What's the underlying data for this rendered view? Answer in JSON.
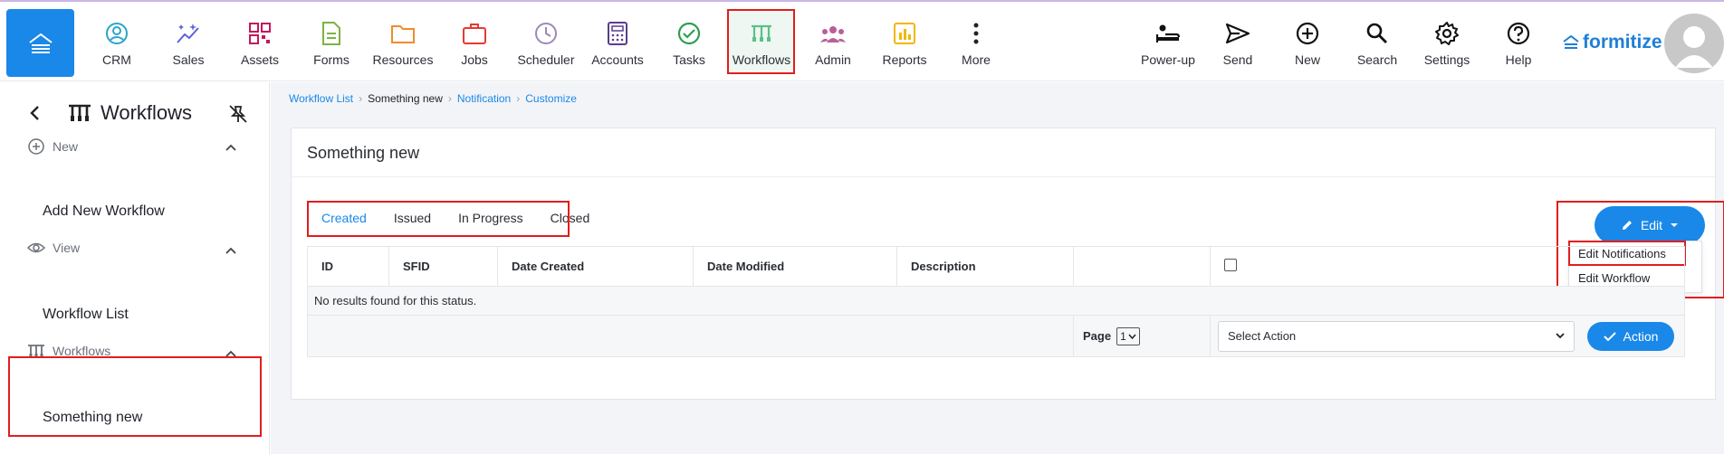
{
  "nav": {
    "items": [
      {
        "label": "CRM",
        "icon": "user-circle-icon"
      },
      {
        "label": "Sales",
        "icon": "sparkle-chart-icon"
      },
      {
        "label": "Assets",
        "icon": "qr-code-icon"
      },
      {
        "label": "Forms",
        "icon": "document-icon"
      },
      {
        "label": "Resources",
        "icon": "folder-icon"
      },
      {
        "label": "Jobs",
        "icon": "briefcase-icon"
      },
      {
        "label": "Scheduler",
        "icon": "clock-icon"
      },
      {
        "label": "Accounts",
        "icon": "calculator-icon"
      },
      {
        "label": "Tasks",
        "icon": "check-circle-icon"
      },
      {
        "label": "Workflows",
        "icon": "workflow-icon"
      },
      {
        "label": "Admin",
        "icon": "people-icon"
      },
      {
        "label": "Reports",
        "icon": "bar-chart-icon"
      },
      {
        "label": "More",
        "icon": "more-vertical-icon"
      }
    ],
    "right_items": [
      {
        "label": "Power-up",
        "icon": "power-up-icon"
      },
      {
        "label": "Send",
        "icon": "send-icon"
      },
      {
        "label": "New",
        "icon": "plus-circle-icon"
      },
      {
        "label": "Search",
        "icon": "search-icon"
      },
      {
        "label": "Settings",
        "icon": "gear-icon"
      },
      {
        "label": "Help",
        "icon": "help-icon"
      }
    ],
    "brand": "formitize"
  },
  "sidebar": {
    "title": "Workflows",
    "sections": [
      {
        "label": "New",
        "link": "Add New Workflow"
      },
      {
        "label": "View",
        "link": "Workflow List"
      },
      {
        "label": "Workflows",
        "link": "Something new"
      }
    ]
  },
  "breadcrumb": [
    "Workflow List",
    "Something new",
    "Notification",
    "Customize"
  ],
  "card": {
    "title": "Something new",
    "tabs": [
      "Created",
      "Issued",
      "In Progress",
      "Closed"
    ],
    "edit_label": "Edit",
    "dropdown": [
      "Edit Notifications",
      "Edit Workflow"
    ],
    "columns": [
      "ID",
      "SFID",
      "Date Created",
      "Date Modified",
      "Description"
    ],
    "empty_message": "No results found for this status.",
    "page_label": "Page",
    "page_value": "1",
    "select_action": "Select Action",
    "action_label": "Action"
  },
  "colors": {
    "primary": "#1a88e8",
    "highlight": "#e11d1d"
  }
}
